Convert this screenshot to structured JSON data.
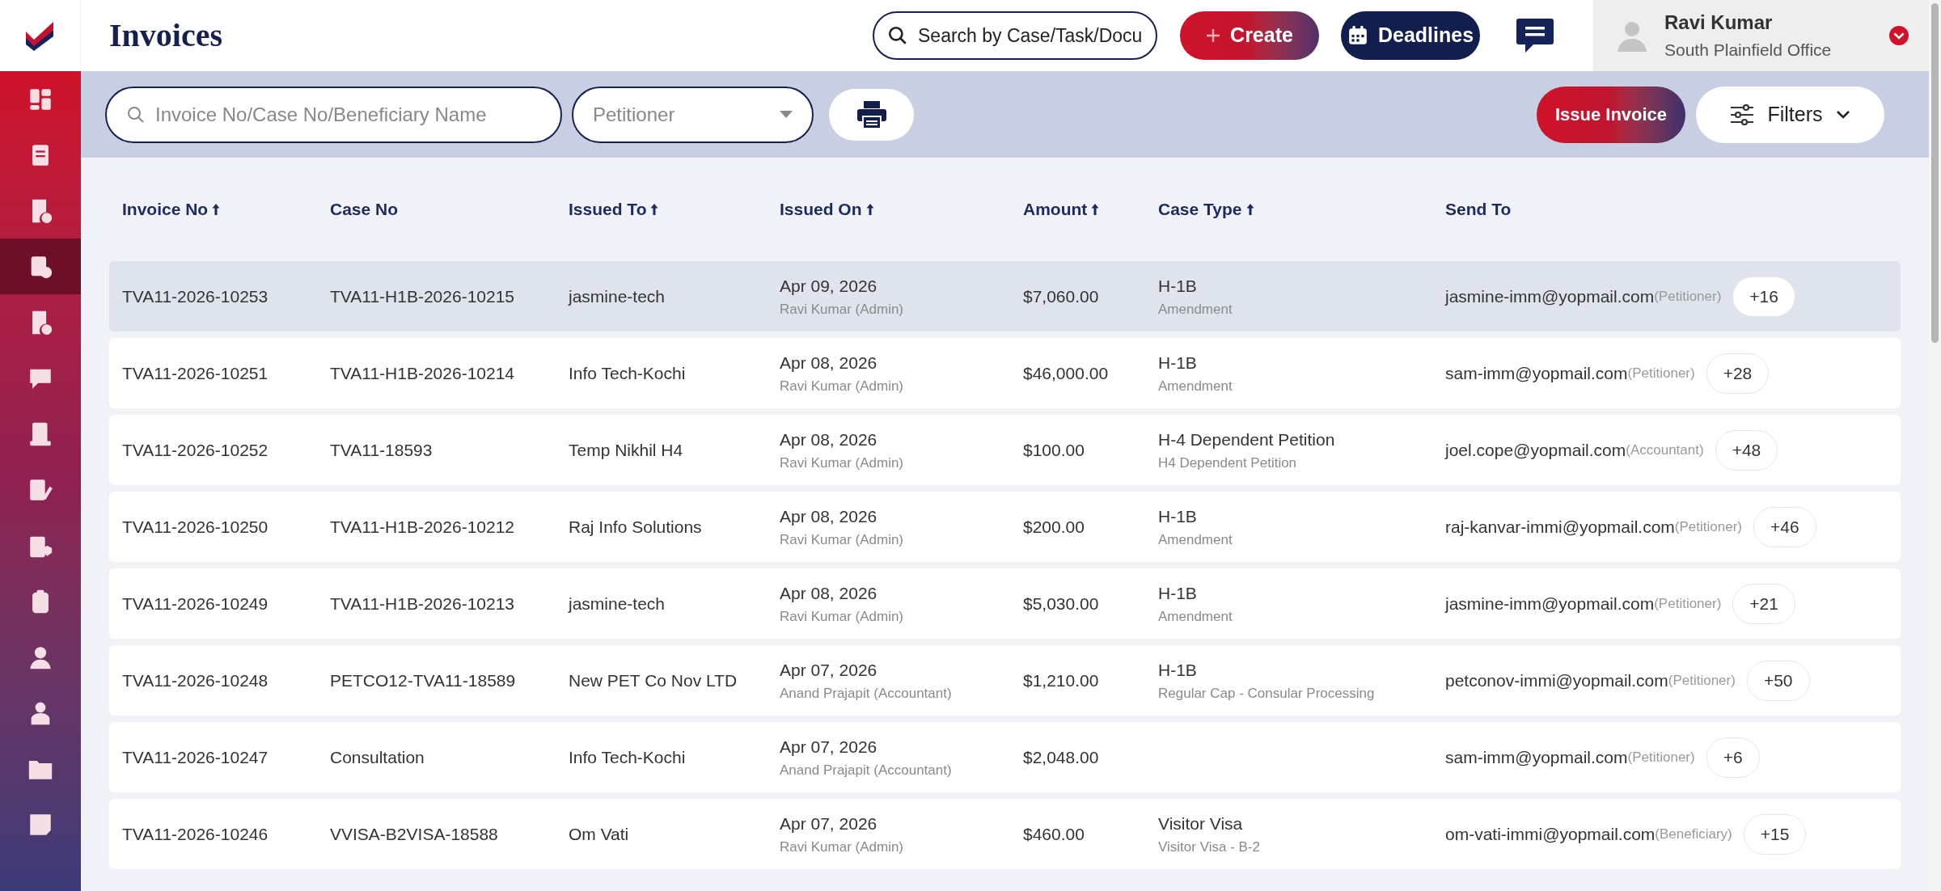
{
  "header": {
    "title": "Invoices",
    "search": {
      "placeholder": "Search by Case/Task/Docu"
    },
    "create_button": "Create",
    "deadlines_button": "Deadlines",
    "user": {
      "name": "Ravi Kumar",
      "office": "South Plainfield Office"
    }
  },
  "sidebar": {
    "items": [
      {
        "selected": false
      },
      {
        "selected": false
      },
      {
        "selected": false
      },
      {
        "selected": true
      },
      {
        "selected": false
      },
      {
        "selected": false
      },
      {
        "selected": false
      },
      {
        "selected": false
      },
      {
        "selected": false
      },
      {
        "selected": false
      },
      {
        "selected": false
      },
      {
        "selected": false
      },
      {
        "selected": false
      },
      {
        "selected": false
      }
    ]
  },
  "toolbar": {
    "search": {
      "placeholder": "Invoice No/Case No/Beneficiary Name"
    },
    "select": {
      "value": "Petitioner"
    },
    "issue_button": "Issue Invoice",
    "filters_button": "Filters"
  },
  "table": {
    "columns": [
      {
        "label": "Invoice No",
        "sortable": true
      },
      {
        "label": "Case No",
        "sortable": false
      },
      {
        "label": "Issued To",
        "sortable": true
      },
      {
        "label": "Issued On",
        "sortable": true
      },
      {
        "label": "Amount",
        "sortable": true
      },
      {
        "label": "Case Type",
        "sortable": true
      },
      {
        "label": "Send To",
        "sortable": false
      }
    ],
    "rows": [
      {
        "highlighted": true,
        "invoice": "TVA11-2026-10253",
        "case": "TVA11-H1B-2026-10215",
        "issued_to": "jasmine-tech",
        "date": "Apr 09, 2026",
        "issued_by": "Ravi Kumar (Admin)",
        "amount": "$7,060.00",
        "case_type": "H-1B",
        "case_subtype": "Amendment",
        "email": "jasmine-imm@yopmail.com",
        "role": "(Petitioner)",
        "more": "+16"
      },
      {
        "highlighted": false,
        "invoice": "TVA11-2026-10251",
        "case": "TVA11-H1B-2026-10214",
        "issued_to": "Info Tech-Kochi",
        "date": "Apr 08, 2026",
        "issued_by": "Ravi Kumar (Admin)",
        "amount": "$46,000.00",
        "case_type": "H-1B",
        "case_subtype": "Amendment",
        "email": "sam-imm@yopmail.com",
        "role": "(Petitioner)",
        "more": "+28"
      },
      {
        "highlighted": false,
        "invoice": "TVA11-2026-10252",
        "case": "TVA11-18593",
        "issued_to": "Temp Nikhil H4",
        "date": "Apr 08, 2026",
        "issued_by": "Ravi Kumar (Admin)",
        "amount": "$100.00",
        "case_type": "H-4 Dependent Petition",
        "case_subtype": "H4 Dependent Petition",
        "email": "joel.cope@yopmail.com",
        "role": "(Accountant)",
        "more": "+48"
      },
      {
        "highlighted": false,
        "invoice": "TVA11-2026-10250",
        "case": "TVA11-H1B-2026-10212",
        "issued_to": "Raj Info Solutions",
        "date": "Apr 08, 2026",
        "issued_by": "Ravi Kumar (Admin)",
        "amount": "$200.00",
        "case_type": "H-1B",
        "case_subtype": "Amendment",
        "email": "raj-kanvar-immi@yopmail.com",
        "role": "(Petitioner)",
        "more": "+46"
      },
      {
        "highlighted": false,
        "invoice": "TVA11-2026-10249",
        "case": "TVA11-H1B-2026-10213",
        "issued_to": "jasmine-tech",
        "date": "Apr 08, 2026",
        "issued_by": "Ravi Kumar (Admin)",
        "amount": "$5,030.00",
        "case_type": "H-1B",
        "case_subtype": "Amendment",
        "email": "jasmine-imm@yopmail.com",
        "role": "(Petitioner)",
        "more": "+21"
      },
      {
        "highlighted": false,
        "invoice": "TVA11-2026-10248",
        "case": "PETCO12-TVA11-18589",
        "issued_to": "New PET Co Nov LTD",
        "date": "Apr 07, 2026",
        "issued_by": "Anand Prajapit (Accountant)",
        "amount": "$1,210.00",
        "case_type": "H-1B",
        "case_subtype": "Regular Cap - Consular Processing",
        "email": "petconov-immi@yopmail.com",
        "role": "(Petitioner)",
        "more": "+50"
      },
      {
        "highlighted": false,
        "invoice": "TVA11-2026-10247",
        "case": "Consultation",
        "issued_to": "Info Tech-Kochi",
        "date": "Apr 07, 2026",
        "issued_by": "Anand Prajapit (Accountant)",
        "amount": "$2,048.00",
        "email": "sam-imm@yopmail.com",
        "role": "(Petitioner)",
        "more": "+6"
      },
      {
        "highlighted": false,
        "invoice": "TVA11-2026-10246",
        "case": "VVISA-B2VISA-18588",
        "issued_to": "Om Vati",
        "date": "Apr 07, 2026",
        "issued_by": "Ravi Kumar (Admin)",
        "amount": "$460.00",
        "case_type": "Visitor Visa",
        "case_subtype": "Visitor Visa - B-2",
        "email": "om-vati-immi@yopmail.com",
        "role": "(Beneficiary)",
        "more": "+15"
      }
    ]
  }
}
